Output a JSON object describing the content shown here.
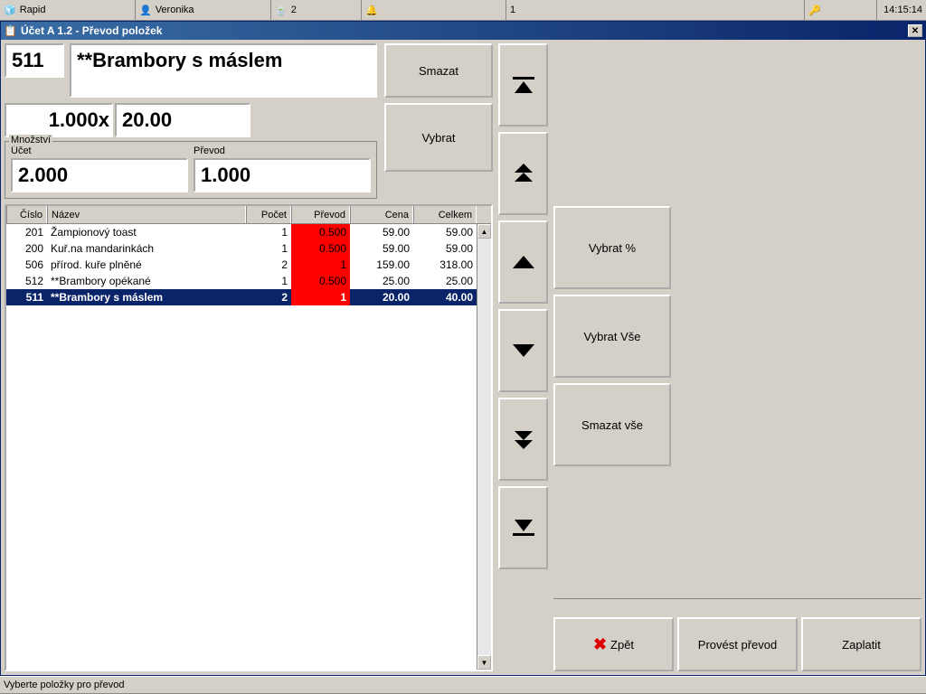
{
  "topbar": {
    "rapid": "Rapid",
    "user": "Veronika",
    "count1": "2",
    "count2": "1",
    "time": "14:15:14"
  },
  "window": {
    "title": "Účet A 1.2 - Převod položek"
  },
  "current": {
    "code": "511",
    "name": "**Brambory s máslem",
    "qty": "1.000",
    "price": "20.00"
  },
  "buttons": {
    "smazat": "Smazat",
    "vybrat": "Vybrat",
    "vybrat_pct": "Vybrat %",
    "vybrat_vse": "Vybrat Vše",
    "smazat_vse": "Smazat vše",
    "zpet": "Zpět",
    "provest": "Provést převod",
    "zaplatit": "Zaplatit"
  },
  "mnozstvi": {
    "legend": "Množství",
    "ucet_label": "Účet",
    "ucet_value": "2.000",
    "prevod_label": "Převod",
    "prevod_value": "1.000"
  },
  "grid": {
    "headers": {
      "cislo": "Číslo",
      "nazev": "Název",
      "pocet": "Počet",
      "prevod": "Převod",
      "cena": "Cena",
      "celkem": "Celkem"
    },
    "rows": [
      {
        "cislo": "201",
        "nazev": "Žampionový toast",
        "pocet": "1",
        "prevod": "0.500",
        "cena": "59.00",
        "celkem": "59.00",
        "sel": false
      },
      {
        "cislo": "200",
        "nazev": "Kuř.na mandarinkách",
        "pocet": "1",
        "prevod": "0.500",
        "cena": "59.00",
        "celkem": "59.00",
        "sel": false
      },
      {
        "cislo": "506",
        "nazev": "přírod. kuře plněné",
        "pocet": "2",
        "prevod": "1",
        "cena": "159.00",
        "celkem": "318.00",
        "sel": false
      },
      {
        "cislo": "512",
        "nazev": "**Brambory opékané",
        "pocet": "1",
        "prevod": "0.500",
        "cena": "25.00",
        "celkem": "25.00",
        "sel": false
      },
      {
        "cislo": "511",
        "nazev": "**Brambory s máslem",
        "pocet": "2",
        "prevod": "1",
        "cena": "20.00",
        "celkem": "40.00",
        "sel": true
      }
    ]
  },
  "status": "Vyberte položky pro převod"
}
